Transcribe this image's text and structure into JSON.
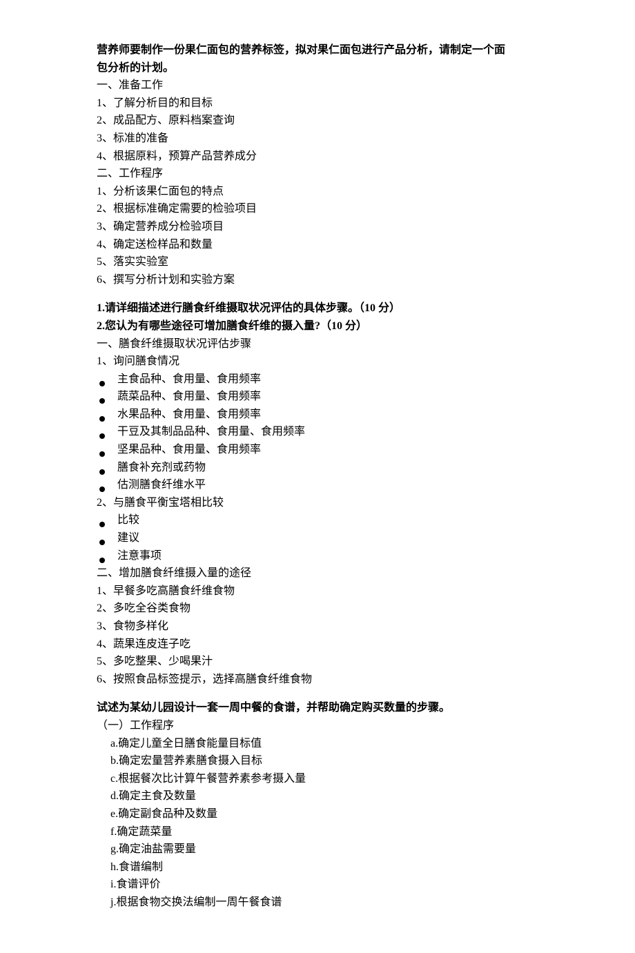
{
  "s1": {
    "titleA": "营养师要制作一份果仁面包的营养标签，拟对果仁面包进行产品分析，请制定一个面",
    "titleB": "包分析的计划。",
    "h1": "一、准备工作",
    "p1": "1、了解分析目的和目标",
    "p2": "2、成品配方、原料档案查询",
    "p3": "3、标准的准备",
    "p4": "4、根据原料，预算产品营养成分",
    "h2": "二、工作程序",
    "q1": "1、分析该果仁面包的特点",
    "q2": "2、根据标准确定需要的检验项目",
    "q3": "3、确定营养成分检验项目",
    "q4": "4、确定送检样品和数量",
    "q5": "5、落实实验室",
    "q6": "6、撰写分析计划和实验方案"
  },
  "s2": {
    "title1": "1.请详细描述进行膳食纤维摄取状况评估的具体步骤。（10 分）",
    "title2": "2.您认为有哪些途径可增加膳食纤维的摄入量?（10 分）",
    "h1": "一、膳食纤维摄取状况评估步骤",
    "p1": "1、询问膳食情况",
    "b1": "主食品种、食用量、食用频率",
    "b2": "蔬菜品种、食用量、食用频率",
    "b3": "水果品种、食用量、食用频率",
    "b4": "干豆及其制品品种、食用量、食用频率",
    "b5": "坚果品种、食用量、食用频率",
    "b6": "膳食补充剂或药物",
    "b7": "估测膳食纤维水平",
    "p2": "2、与膳食平衡宝塔相比较",
    "c1": "比较",
    "c2": "建议",
    "c3": "注意事项",
    "h2": "二、增加膳食纤维摄入量的途径",
    "q1": "1、早餐多吃高膳食纤维食物",
    "q2": "2、多吃全谷类食物",
    "q3": "3、食物多样化",
    "q4": "4、蔬果连皮连子吃",
    "q5": "5、多吃整果、少喝果汁",
    "q6": "6、按照食品标签提示，选择高膳食纤维食物"
  },
  "s3": {
    "title": "试述为某幼儿园设计一套一周中餐的食谱，并帮助确定购买数量的步骤。",
    "h1": "（一）工作程序",
    "a": "a.确定儿童全日膳食能量目标值",
    "b": "b.确定宏量营养素膳食摄入目标",
    "c": "c.根据餐次比计算午餐营养素参考摄入量",
    "d": "d.确定主食及数量",
    "e": "e.确定副食品种及数量",
    "f": "f.确定蔬菜量",
    "g": "g.确定油盐需要量",
    "h": "h.食谱编制",
    "i": "i.食谱评价",
    "j": "j.根据食物交换法编制一周午餐食谱"
  }
}
